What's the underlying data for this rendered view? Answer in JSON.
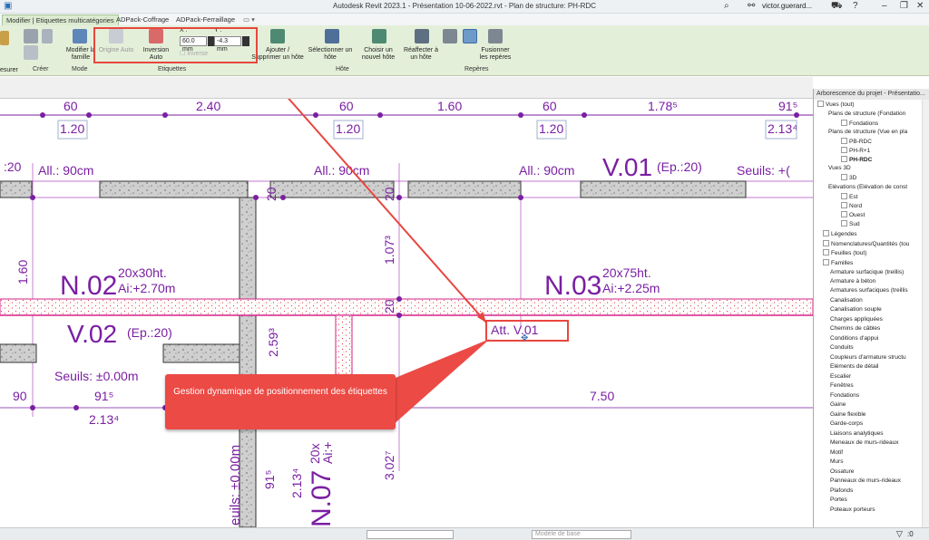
{
  "window": {
    "title": "Autodesk Revit 2023.1 - Présentation 10-06-2022.rvt - Plan de structure: PH-RDC",
    "user": "victor.guerard..."
  },
  "tabs": [
    {
      "label": "Modifier | Etiquettes multicatégories",
      "active": true
    },
    {
      "label": "ADPack-Coffrage"
    },
    {
      "label": "ADPack-Ferraillage"
    },
    {
      "label": "▭ ▾"
    }
  ],
  "ribbon": {
    "mesurer": "esurer",
    "creer": "Créer",
    "modifier_famille": "Modifier la famille",
    "mode": "Mode",
    "origine_auto": "Origine Auto",
    "inversion_auto": "Inversion Auto",
    "inverse": "Inverse",
    "x_label": "X :",
    "y_label": "Y :",
    "x_value": "60.0 mm",
    "y_value": "-4.3 mm",
    "etiquettes": "Etiquettes",
    "ajouter": "Ajouter / Supprimer un hôte",
    "selectionner": "Sélectionner un hôte",
    "choisir": "Choisir un nouvel hôte",
    "reaffecter": "Réaffecter à un hôte",
    "hote": "Hôte",
    "fusionner": "Fusionner les repères",
    "reperes": "Repères"
  },
  "drawing": {
    "top_dims": [
      "60",
      "1.20",
      "2.40",
      "60",
      "1.20",
      "1.60",
      "60",
      "1.20",
      "1.78⁵",
      "91⁵",
      "2.13⁴"
    ],
    "all1": "All.: 90cm",
    "all2": "All.: 90cm",
    "all3": "All.: 90cm",
    "v01": "V.01",
    "v01_ep": "(Ep.:20)",
    "seuils_r": "Seuils: +(",
    "left20": ":20",
    "n02": "N.02",
    "n02_dim": "20x30ht.",
    "n02_ai": "Ai:+2.70m",
    "n03": "N.03",
    "n03_dim": "20x75ht.",
    "n03_ai": "Ai:+2.25m",
    "v02": "V.02",
    "v02_ep": "(Ep.:20)",
    "seuils_l": "Seuils: ±0.00m",
    "att": "Att. V.01",
    "d90": "90",
    "d915": "91⁵",
    "d2134": "2.13⁴",
    "d750": "7.50",
    "d160": "1.60",
    "d1073": "1.07³",
    "d2593": "2.59³",
    "d3027": "3.02⁷",
    "d20a": "20",
    "d20b": "20",
    "d20c": "20",
    "seuils_v": "euils: ±0.00m",
    "n07": "N.07",
    "n07_a": "20x",
    "n07_b": "Ai:+",
    "v915": "91⁵",
    "v2134": "2.13⁴"
  },
  "callout": {
    "text": "Gestion dynamique de positionnement des étiquettes"
  },
  "browser": {
    "title": "Arborescence du projet - Présentatio...",
    "items": [
      "Vues (tout)",
      "Plans de structure (Fondation",
      "Fondations",
      "Plans de structure (Vue en pla",
      "PB-RDC",
      "PH-R+1",
      "PH-RDC",
      "Vues 3D",
      "3D",
      "Elévations (Elévation de const",
      "Est",
      "Nord",
      "Ouest",
      "Sud",
      "Légendes",
      "Nomenclatures/Quantités (tou",
      "Feuilles (tout)",
      "Familles",
      "Armature surfacique (treillis)",
      "Armature à béton",
      "Armatures surfaciques (treillis",
      "Canalisation",
      "Canalisation souple",
      "Charges appliquées",
      "Chemins de câbles",
      "Conditions d'appui",
      "Conduits",
      "Coupleurs d'armature structu",
      "Eléments de détail",
      "Escalier",
      "Fenêtres",
      "Fondations",
      "Gaine",
      "Gaine flexible",
      "Garde-corps",
      "Liaisons analytiques",
      "Meneaux de murs-rideaux",
      "Motif",
      "Murs",
      "Ossature",
      "Panneaux de murs-rideaux",
      "Plafonds",
      "Portes",
      "Poteaux porteurs"
    ]
  },
  "status": {
    "model": "Modèle de base",
    "filter": ":0"
  },
  "colors": {
    "ribbon": "#e4efd9",
    "accent": "#e8463f",
    "callout": "#ec4a45",
    "purple": "#7a1fa2",
    "magenta": "#d6228a"
  }
}
